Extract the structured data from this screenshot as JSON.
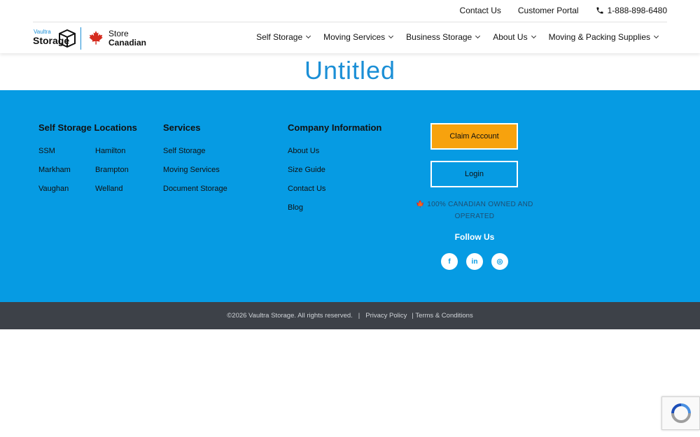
{
  "topbar": {
    "contact": "Contact Us",
    "portal": "Customer Portal",
    "phone": "1-888-898-6480"
  },
  "logo": {
    "small": "Vaultra",
    "big": "Storage",
    "store": "Store",
    "canadian": "Canadian"
  },
  "nav": {
    "items": [
      {
        "label": "Self Storage"
      },
      {
        "label": "Moving Services"
      },
      {
        "label": "Business Storage"
      },
      {
        "label": "About Us"
      },
      {
        "label": "Moving & Packing Supplies"
      }
    ]
  },
  "page": {
    "title": "Untitled"
  },
  "footer": {
    "locations": {
      "heading": "Self Storage Locations",
      "col_a": [
        "SSM",
        "Markham",
        "Vaughan"
      ],
      "col_b": [
        "Hamilton",
        "Brampton",
        "Welland"
      ]
    },
    "services": {
      "heading": "Services",
      "links": [
        "Self Storage",
        "Moving Services",
        "Document Storage"
      ]
    },
    "company": {
      "heading": "Company Information",
      "links": [
        "About Us",
        "Size Guide",
        "Contact Us",
        "Blog"
      ]
    },
    "claim": "Claim Account",
    "login": "Login",
    "owned": "100% CANADIAN OWNED AND OPERATED",
    "follow": "Follow Us",
    "social": {
      "facebook": "f",
      "linkedin": "in",
      "instagram": "◎"
    }
  },
  "bottom": {
    "copyright": "©2026 Vaultra Storage. All rights reserved.",
    "sep": "|",
    "privacy": "Privacy Policy",
    "terms": "| Terms & Conditions"
  },
  "colors": {
    "brand": "#1b8fd6",
    "footer_bg": "#069be3",
    "claim_bg": "#f7a20d",
    "bottom_bg": "#3d4148"
  }
}
